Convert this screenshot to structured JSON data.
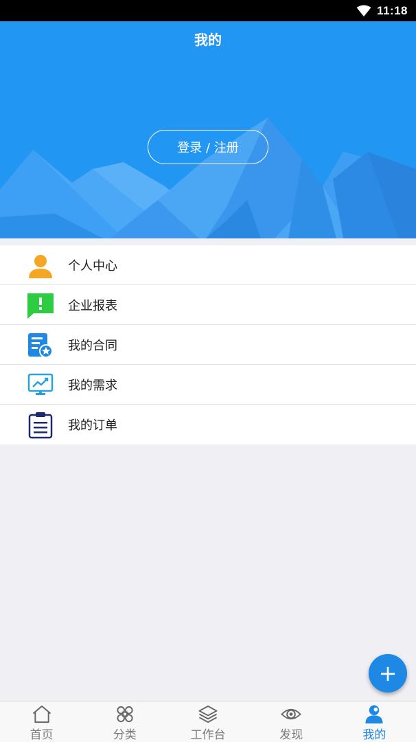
{
  "status_bar": {
    "time": "11:18",
    "icons": [
      "wifi-icon"
    ]
  },
  "header": {
    "title": "我的"
  },
  "login": {
    "label": "登录 / 注册"
  },
  "menu": {
    "items": [
      {
        "label": "个人中心",
        "icon": "person-icon",
        "color": "#f5a623"
      },
      {
        "label": "企业报表",
        "icon": "alert-message-icon",
        "color": "#2ecc40"
      },
      {
        "label": "我的合同",
        "icon": "contract-badge-icon",
        "color": "#1e88e5"
      },
      {
        "label": "我的需求",
        "icon": "chart-monitor-icon",
        "color": "#29a3e0"
      },
      {
        "label": "我的订单",
        "icon": "clipboard-icon",
        "color": "#1a2a6c"
      }
    ]
  },
  "fab": {
    "label": "+"
  },
  "tabbar": {
    "active": "我的",
    "active_color": "#1e88e5",
    "items": [
      {
        "label": "首页",
        "icon": "home-icon"
      },
      {
        "label": "分类",
        "icon": "command-icon"
      },
      {
        "label": "工作台",
        "icon": "layers-icon"
      },
      {
        "label": "发现",
        "icon": "eye-icon"
      },
      {
        "label": "我的",
        "icon": "user-icon"
      }
    ]
  },
  "colors": {
    "hero": "#2196f3",
    "background": "#f0eff4",
    "accent": "#1e88e5"
  }
}
